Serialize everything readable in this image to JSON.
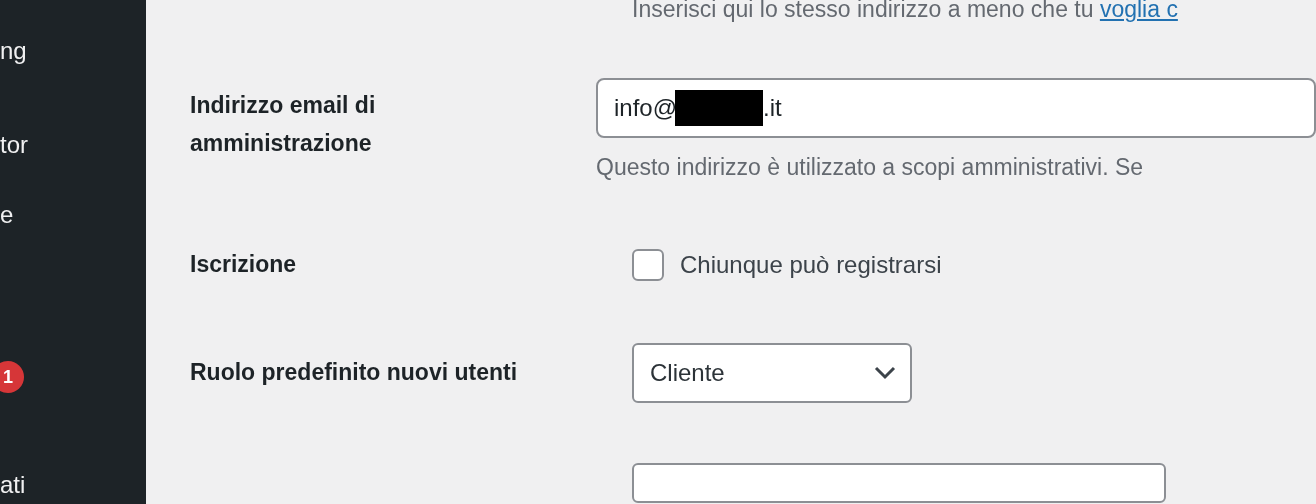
{
  "sidebar": {
    "items": [
      {
        "label": "ng"
      },
      {
        "label": "tor"
      },
      {
        "label": "e"
      },
      {
        "badge": "1"
      },
      {
        "label": "ati"
      }
    ]
  },
  "intro": {
    "text": "Inserisci qui lo stesso indirizzo a meno che tu",
    "link": "voglia c"
  },
  "admin_email": {
    "label": "Indirizzo email di amministrazione",
    "value_before": "info@",
    "value_after": ".it",
    "redacted": true,
    "description": "Questo indirizzo è utilizzato a scopi amministrativi. Se"
  },
  "membership": {
    "label": "Iscrizione",
    "option": "Chiunque può registrarsi",
    "checked": false
  },
  "default_role": {
    "label": "Ruolo predefinito nuovi utenti",
    "value": "Cliente"
  }
}
